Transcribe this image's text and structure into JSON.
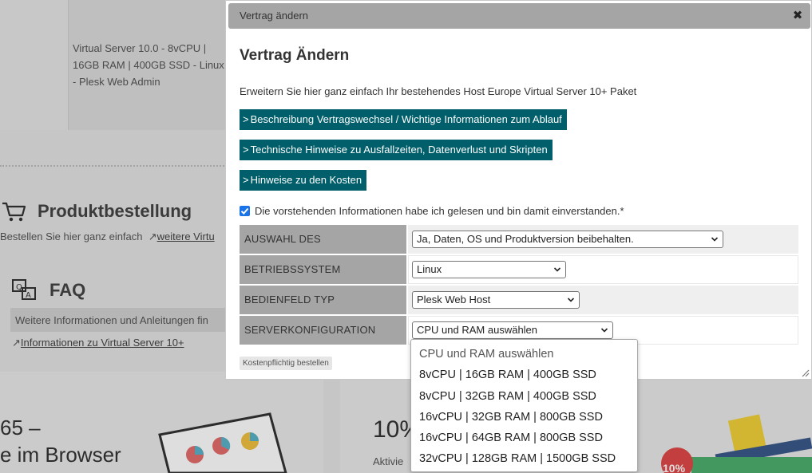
{
  "background": {
    "product_description": "Virtual Server 10.0 - 8vCPU | 16GB RAM | 400GB SSD - Linux - Plesk Web Admin",
    "order_section": {
      "title": "Produktbestellung",
      "text": "Bestellen Sie hier ganz einfach",
      "link": "weitere Virtu"
    },
    "faq_section": {
      "title": "FAQ",
      "text": "Weitere Informationen und Anleitungen fin",
      "link": "Informationen zu Virtual Server 10+"
    },
    "promo_left": {
      "line1": "65 –",
      "line2": "e im Browser"
    },
    "promo_right": {
      "big": "10%",
      "small": "Aktivie",
      "badge": "10%"
    }
  },
  "dialog": {
    "title": "Vertrag ändern",
    "close_symbol": "✖",
    "heading": "Vertrag Ändern",
    "intro": "Erweitern Sie hier ganz einfach Ihr bestehendes Host Europe Virtual Server 10+ Paket",
    "info_buttons": [
      "Beschreibung Vertragswechsel / Wichtige Informationen zum Ablauf",
      "Technische Hinweise zu Ausfallzeiten, Datenverlust und Skripten",
      "Hinweise zu den Kosten"
    ],
    "agree_label": "Die vorstehenden Informationen habe ich gelesen und bin damit einverstanden.*",
    "agree_checked": true,
    "form": {
      "order_type": {
        "label": "AUSWAHL DES AUFTRAGSTYPS",
        "value": "Ja, Daten, OS und Produktversion beibehalten."
      },
      "os": {
        "label": "BETRIEBSSYSTEM",
        "value": "Linux"
      },
      "panel": {
        "label": "BEDIENFELD TYP",
        "value": "Plesk Web Host"
      },
      "server_config": {
        "label": "SERVERKONFIGURATION",
        "value": "CPU und RAM auswählen"
      }
    },
    "order_button": "Kostenpflichtig bestellen"
  },
  "server_config_options": [
    "CPU und RAM auswählen",
    "8vCPU | 16GB RAM | 400GB SSD",
    "8vCPU | 32GB RAM | 400GB SSD",
    "16vCPU | 32GB RAM | 800GB SSD",
    "16vCPU | 64GB RAM | 800GB SSD",
    "32vCPU | 128GB RAM | 1500GB SSD"
  ],
  "colors": {
    "teal": "#005f6b",
    "titlebar": "#a5a5a5",
    "checkbox": "#1a73e8"
  }
}
